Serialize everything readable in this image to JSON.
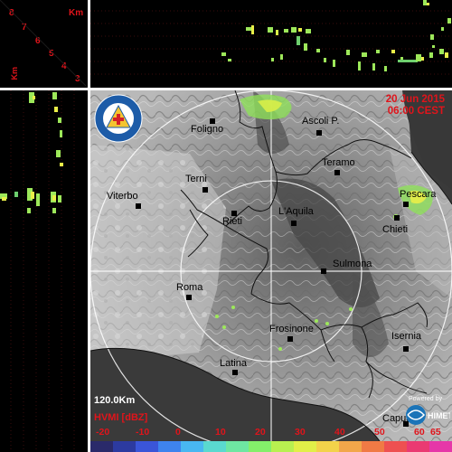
{
  "datetime": {
    "date": "20 Jun 2015",
    "time": "06:00 CEST"
  },
  "km_axis": {
    "unit": "Km",
    "heights": [
      "8",
      "7",
      "6",
      "5",
      "4",
      "3"
    ]
  },
  "vertical_axis_unit": "Km",
  "scale": "120.0Km",
  "units": "HVMI [dBZ]",
  "powered_by": "Powered by",
  "logos": {
    "protezione_civile": "PROTEZIONE CIVILE · REGIONE ABRUZZO",
    "himet": "HIMET"
  },
  "cities": [
    {
      "name": "Foligno"
    },
    {
      "name": "Ascoli P."
    },
    {
      "name": "Teramo"
    },
    {
      "name": "Terni"
    },
    {
      "name": "Viterbo"
    },
    {
      "name": "Rieti"
    },
    {
      "name": "L'Aquila"
    },
    {
      "name": "Pescara"
    },
    {
      "name": "Chieti"
    },
    {
      "name": "Sulmona"
    },
    {
      "name": "Roma"
    },
    {
      "name": "Frosinone"
    },
    {
      "name": "Isernia"
    },
    {
      "name": "Latina"
    },
    {
      "name": "Capua"
    }
  ],
  "colorbar": {
    "ticks": [
      "-20",
      "-10",
      "0",
      "10",
      "20",
      "30",
      "40",
      "50",
      "60",
      "65"
    ],
    "colors": [
      "#2a2a6a",
      "#2c3aa0",
      "#3a55d8",
      "#3e83ee",
      "#48b7f1",
      "#5ad9cf",
      "#6ee6a2",
      "#84ef6a",
      "#b8f050",
      "#e2ef48",
      "#f3d24a",
      "#f2a64a",
      "#f07a45",
      "#ee5051",
      "#ea3a72",
      "#e637a8"
    ],
    "accent": "#e0141b"
  }
}
